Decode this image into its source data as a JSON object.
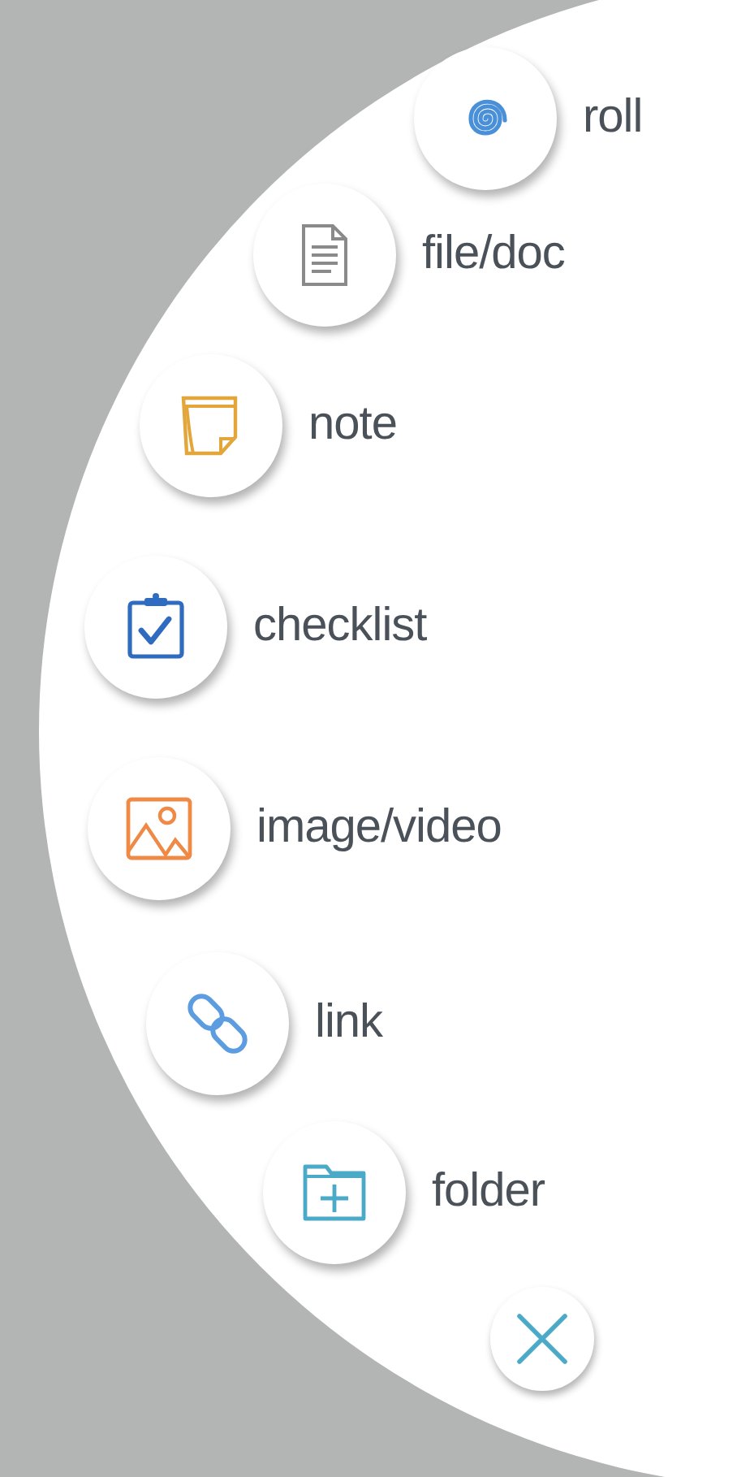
{
  "menu_items": [
    {
      "label": "roll",
      "kind": "spiral"
    },
    {
      "label": "file/doc",
      "kind": "document"
    },
    {
      "label": "note",
      "kind": "note"
    },
    {
      "label": "checklist",
      "kind": "checklist"
    },
    {
      "label": "image/video",
      "kind": "image"
    },
    {
      "label": "link",
      "kind": "link"
    },
    {
      "label": "folder",
      "kind": "folder"
    }
  ]
}
